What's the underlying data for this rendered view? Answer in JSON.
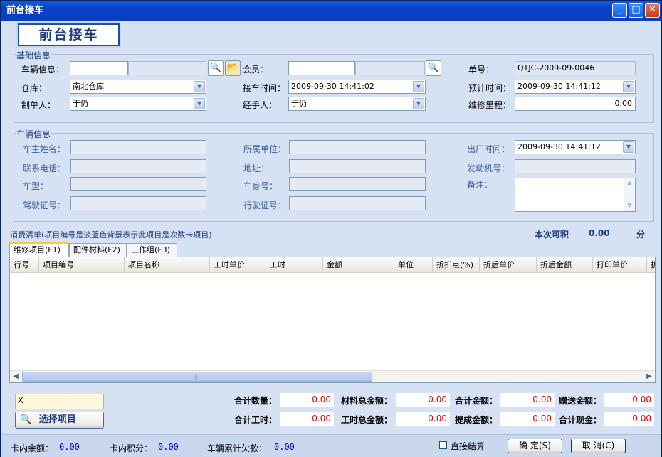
{
  "window": {
    "title": "前台接车",
    "min": "_",
    "max": "□",
    "close": "✕"
  },
  "banner": "前台接车",
  "basic": {
    "legend": "基础信息",
    "vehicle_info_label": "车辆信息：",
    "vehicle_info_value": "",
    "member_label": "会员：",
    "member_value": "",
    "order_no_label": "单号：",
    "order_no_value": "QTJC-2009-09-0046",
    "warehouse_label": "仓库：",
    "warehouse_value": "南北仓库",
    "receive_time_label": "接车时间：",
    "receive_time_value": "2009-09-30 14:41:02",
    "expected_time_label": "预计时间：",
    "expected_time_value": "2009-09-30 14:41:12",
    "maker_label": "制单人：",
    "maker_value": "于仍",
    "handler_label": "经手人：",
    "handler_value": "于仍",
    "mileage_label": "维修里程：",
    "mileage_value": "0.00"
  },
  "vehicle": {
    "legend": "车辆信息",
    "owner_label": "车主姓名：",
    "unit_label": "所属单位：",
    "out_time_label": "出厂时间：",
    "out_time_value": "2009-09-30 14:41:12",
    "phone_label": "联系电话：",
    "address_label": "地址：",
    "engine_label": "发动机号：",
    "model_label": "车型：",
    "body_label": "车身号：",
    "remark_label": "备注：",
    "license_label": "驾驶证号：",
    "reg_label": "行驶证号："
  },
  "consume": {
    "title": "消费清单(项目编号是淡蓝色背景表示此项目是次数卡项目)",
    "points_label": "本次可积",
    "points_value": "0.00",
    "points_unit": "分"
  },
  "tabs": [
    "维修项目(F1)",
    "配件材料(F2)",
    "工作组(F3)"
  ],
  "columns": [
    "行号",
    "项目编号",
    "项目名称",
    "工时单价",
    "工时",
    "金额",
    "单位",
    "折扣点(%)",
    "折后单价",
    "折后金额",
    "打印单价",
    "折"
  ],
  "search_value": "X",
  "select_item_label": "选择项目",
  "summary": {
    "qty_label": "合计数量：",
    "qty_value": "0.00",
    "material_label": "材料总金额：",
    "material_value": "0.00",
    "total_label": "合计金额：",
    "total_value": "0.00",
    "gift_label": "赠送金额：",
    "gift_value": "0.00",
    "hours_label": "合计工时：",
    "hours_value": "0.00",
    "labor_label": "工时总金额：",
    "labor_value": "0.00",
    "commission_label": "提成金额：",
    "commission_value": "0.00",
    "cash_label": "合计现金：",
    "cash_value": "0.00"
  },
  "footer": {
    "balance_label": "卡内余额：",
    "balance_value": "0.00",
    "points_label": "卡内积分：",
    "points_value": "0.00",
    "debt_label": "车辆累计欠款：",
    "debt_value": "0.00",
    "direct_settle_label": "直接结算",
    "ok_label": "确 定(S)",
    "cancel_label": "取 消(C)"
  }
}
